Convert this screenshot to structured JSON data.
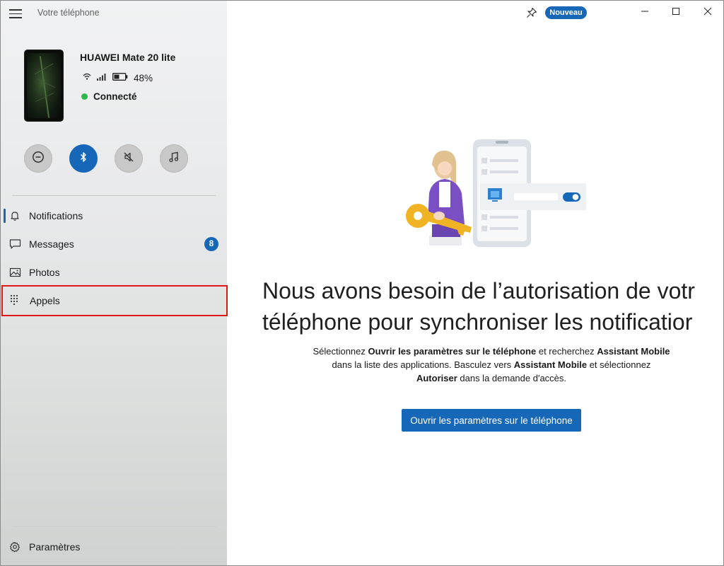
{
  "app": {
    "title": "Votre téléphone"
  },
  "titlebar": {
    "new_badge": "Nouveau"
  },
  "device": {
    "name": "HUAWEI Mate 20 lite",
    "battery": "48%",
    "battery_level": 0.48,
    "status": "Connecté",
    "status_color": "#2db84a"
  },
  "quick_actions": [
    {
      "icon": "do-not-disturb-icon",
      "active": false
    },
    {
      "icon": "bluetooth-icon",
      "active": true
    },
    {
      "icon": "mute-icon",
      "active": false
    },
    {
      "icon": "music-icon",
      "active": false
    }
  ],
  "nav": {
    "notifications": "Notifications",
    "messages": "Messages",
    "messages_badge": "8",
    "photos": "Photos",
    "calls": "Appels",
    "settings": "Paramètres"
  },
  "main": {
    "headline_line1": "Nous avons besoin de l’autorisation de votr",
    "headline_line2": "téléphone pour synchroniser les notificatior",
    "desc": {
      "p1": "Sélectionnez ",
      "b1": "Ouvrir les paramètres sur le téléphone",
      "p2": " et recherchez ",
      "b2": "Assistant Mobile",
      "p3": " dans la liste des applications. Basculez vers ",
      "b3": "Assistant Mobile",
      "p4": " et sélectionnez ",
      "b4": "Autoriser",
      "p5": " dans la demande d'accès."
    },
    "button": "Ouvrir les paramètres sur le téléphone"
  },
  "colors": {
    "accent": "#1767b8",
    "highlight_outline": "#e01818"
  }
}
